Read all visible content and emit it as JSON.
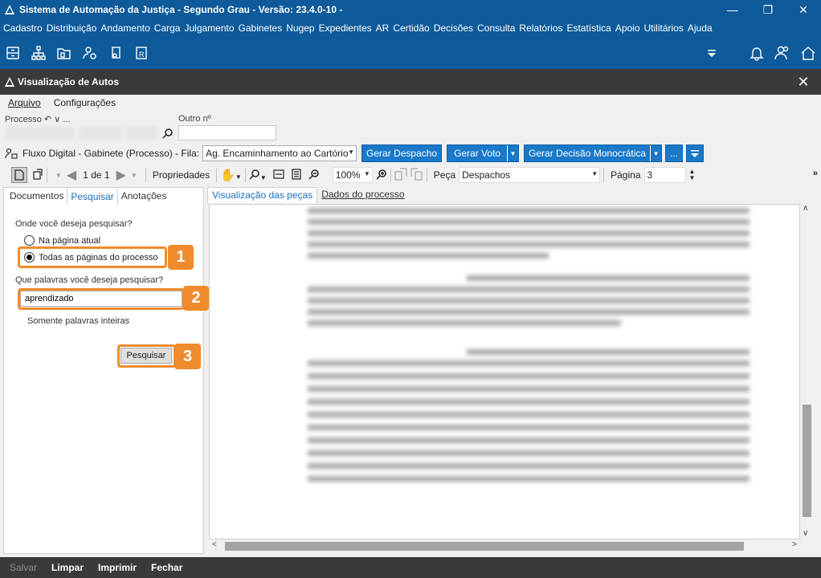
{
  "window": {
    "title": "Sistema de Automação da Justiça - Segundo Grau - Versão: 23.4.0-10 -"
  },
  "menu": [
    "Cadastro",
    "Distribuição",
    "Andamento",
    "Carga",
    "Julgamento",
    "Gabinetes",
    "Nugep",
    "Expedientes",
    "AR",
    "Certidão",
    "Decisões",
    "Consulta",
    "Relatórios",
    "Estatística",
    "Apoio",
    "Utilitários",
    "Ajuda"
  ],
  "subwindow": {
    "title": "Visualização de Autos"
  },
  "submenu": {
    "arquivo": "Arquivo",
    "configuracoes": "Configurações"
  },
  "process": {
    "label": "Processo",
    "outro_label": "Outro nº",
    "arrows": "↶ ∨ ...",
    "outro_value": ""
  },
  "flux": {
    "text": "Fluxo Digital - Gabinete (Processo) - Fila:",
    "queue": "Ag. Encaminhamento ao Cartório"
  },
  "buttons": {
    "gerar_despacho": "Gerar Despacho",
    "gerar_voto": "Gerar Voto",
    "gerar_decisao": "Gerar Decisão Monocrática",
    "more": "..."
  },
  "toolbar2": {
    "page_of": "1 de 1",
    "propriedades": "Propriedades",
    "zoom": "100%",
    "peca_label": "Peça",
    "peca_value": "Despachos",
    "pagina_label": "Página",
    "pagina_value": "3"
  },
  "left_tabs": [
    "Documentos",
    "Pesquisar",
    "Anotações"
  ],
  "search": {
    "question1": "Onde você deseja pesquisar?",
    "option1": "Na página atual",
    "option2": "Todas as páginas do processo",
    "question2": "Que palavras você deseja pesquisar?",
    "input_value": "aprendizado",
    "whole_words": "Somente palavras inteiras",
    "button": "Pesquisar"
  },
  "badges": [
    "1",
    "2",
    "3"
  ],
  "right_tabs": [
    "Visualização das peças",
    "Dados do processo"
  ],
  "bottom": {
    "salvar": "Salvar",
    "limpar": "Limpar",
    "imprimir": "Imprimir",
    "fechar": "Fechar"
  },
  "colors": {
    "primary": "#0e5a9b",
    "button_blue": "#1a78c8",
    "accent_orange": "#ef8b2c",
    "dark_bar": "#3a3a3a"
  }
}
